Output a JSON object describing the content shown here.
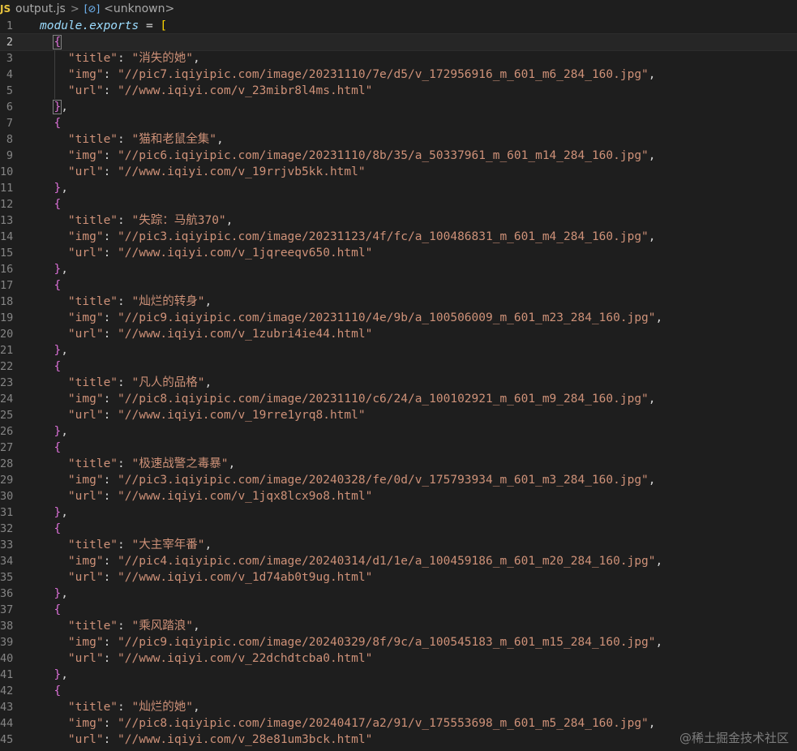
{
  "breadcrumb": {
    "file_badge": "JS",
    "file_name": "output.js",
    "separator": ">",
    "symbol_icon": "[⊘]",
    "symbol_name": "<unknown>"
  },
  "editor": {
    "active_line": 2,
    "header": {
      "kw": "module.exports",
      "op": " = ",
      "bracket": "["
    },
    "items": [
      {
        "title": "消失的她",
        "img": "//pic7.iqiyipic.com/image/20231110/7e/d5/v_172956916_m_601_m6_284_160.jpg",
        "url": "//www.iqiyi.com/v_23mibr8l4ms.html"
      },
      {
        "title": "猫和老鼠全集",
        "img": "//pic6.iqiyipic.com/image/20231110/8b/35/a_50337961_m_601_m14_284_160.jpg",
        "url": "//www.iqiyi.com/v_19rrjvb5kk.html"
      },
      {
        "title": "失踪：马航370",
        "img": "//pic3.iqiyipic.com/image/20231123/4f/fc/a_100486831_m_601_m4_284_160.jpg",
        "url": "//www.iqiyi.com/v_1jqreeqv650.html"
      },
      {
        "title": "灿烂的转身",
        "img": "//pic9.iqiyipic.com/image/20231110/4e/9b/a_100506009_m_601_m23_284_160.jpg",
        "url": "//www.iqiyi.com/v_1zubri4ie44.html"
      },
      {
        "title": "凡人的品格",
        "img": "//pic8.iqiyipic.com/image/20231110/c6/24/a_100102921_m_601_m9_284_160.jpg",
        "url": "//www.iqiyi.com/v_19rre1yrq8.html"
      },
      {
        "title": "极速战警之毒暴",
        "img": "//pic3.iqiyipic.com/image/20240328/fe/0d/v_175793934_m_601_m3_284_160.jpg",
        "url": "//www.iqiyi.com/v_1jqx8lcx9o8.html"
      },
      {
        "title": "大主宰年番",
        "img": "//pic4.iqiyipic.com/image/20240314/d1/1e/a_100459186_m_601_m20_284_160.jpg",
        "url": "//www.iqiyi.com/v_1d74ab0t9ug.html"
      },
      {
        "title": "乘风踏浪",
        "img": "//pic9.iqiyipic.com/image/20240329/8f/9c/a_100545183_m_601_m15_284_160.jpg",
        "url": "//www.iqiyi.com/v_22dchdtcba0.html"
      },
      {
        "title": "灿烂的她",
        "img": "//pic8.iqiyipic.com/image/20240417/a2/91/v_175553698_m_601_m5_284_160.jpg",
        "url": "//www.iqiyi.com/v_28e81um3bck.html"
      }
    ]
  },
  "watermark": "@稀土掘金技术社区",
  "colors": {
    "background": "#1e1e1e",
    "keyword": "#9cdcfe",
    "string": "#ce9178",
    "bracket_outer": "#ffd700",
    "bracket_inner": "#da70d6",
    "line_number": "#858585"
  }
}
